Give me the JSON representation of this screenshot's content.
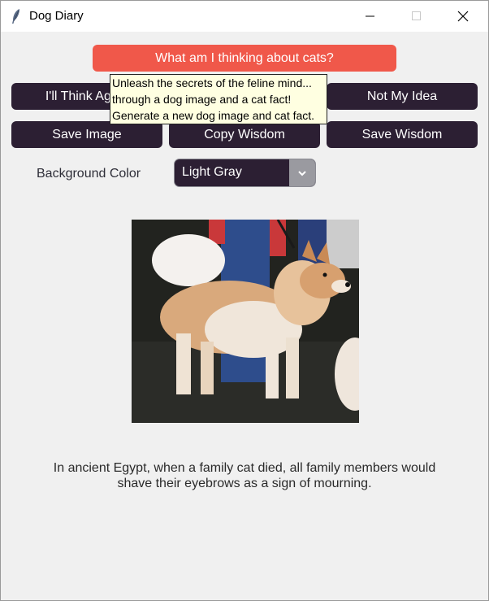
{
  "window": {
    "title": "Dog Diary",
    "icon": "feather-icon",
    "controls": [
      "minimize-icon",
      "maximize-icon",
      "close-icon"
    ]
  },
  "buttons": {
    "primary": "What am I thinking about cats?",
    "think_again": "I'll Think Again",
    "not_my_idea": "Not My Idea",
    "save_image": "Save Image",
    "copy_wisdom": "Copy Wisdom",
    "save_wisdom": "Save Wisdom"
  },
  "background_color": {
    "label": "Background Color",
    "selected": "Light Gray"
  },
  "tooltip": {
    "lines": [
      "Unleash the secrets of the feline mind...",
      "through a dog image and a cat fact!",
      "Generate a new dog image and cat fact."
    ]
  },
  "fact": {
    "line1": "In ancient Egypt, when a family cat died, all family members would",
    "line2": "shave their eyebrows as a sign of mourning."
  },
  "colors": {
    "accent": "#f0584a",
    "button_dark": "#2c1f33",
    "background": "#f0f0f0",
    "tooltip": "#ffffe1"
  }
}
